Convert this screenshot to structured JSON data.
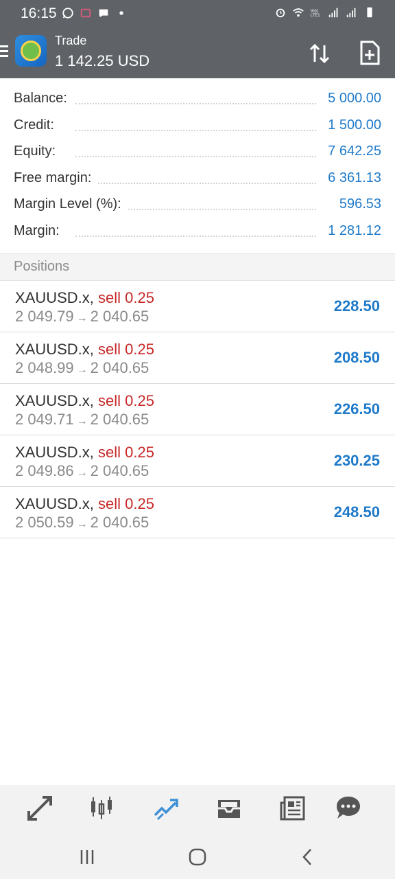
{
  "status_bar": {
    "time": "16:15",
    "icons": [
      "whatsapp-icon",
      "notification-icon",
      "chat-icon",
      "dot-icon"
    ],
    "right_icons": [
      "alarm-icon",
      "wifi-icon",
      "volte-icon",
      "signal-icon",
      "signal-icon",
      "battery-icon"
    ],
    "volte_label": "Vo))\nLTE1"
  },
  "appbar": {
    "title": "Trade",
    "subtitle": "1 142.25 USD"
  },
  "summary": [
    {
      "label": "Balance:",
      "value": "5 000.00"
    },
    {
      "label": "Credit:",
      "value": "1 500.00"
    },
    {
      "label": "Equity:",
      "value": "7 642.25"
    },
    {
      "label": "Free margin:",
      "value": "6 361.13"
    },
    {
      "label": "Margin Level (%):",
      "value": "596.53"
    },
    {
      "label": "Margin:",
      "value": "1 281.12"
    }
  ],
  "positions_header": "Positions",
  "positions": [
    {
      "symbol": "XAUUSD.x,",
      "side": "sell 0.25",
      "open": "2 049.79",
      "current": "2 040.65",
      "profit": "228.50"
    },
    {
      "symbol": "XAUUSD.x,",
      "side": "sell 0.25",
      "open": "2 048.99",
      "current": "2 040.65",
      "profit": "208.50"
    },
    {
      "symbol": "XAUUSD.x,",
      "side": "sell 0.25",
      "open": "2 049.71",
      "current": "2 040.65",
      "profit": "226.50"
    },
    {
      "symbol": "XAUUSD.x,",
      "side": "sell 0.25",
      "open": "2 049.86",
      "current": "2 040.65",
      "profit": "230.25"
    },
    {
      "symbol": "XAUUSD.x,",
      "side": "sell 0.25",
      "open": "2 050.59",
      "current": "2 040.65",
      "profit": "248.50"
    }
  ],
  "arrow": "→",
  "bottom_nav": [
    "quotes-icon",
    "chart-icon",
    "trade-icon",
    "history-icon",
    "news-icon",
    "chat-icon"
  ],
  "colors": {
    "accent": "#1e7ac9",
    "sell": "#c62828",
    "appbar": "#5f6368",
    "active_nav": "#3d8fd6"
  }
}
